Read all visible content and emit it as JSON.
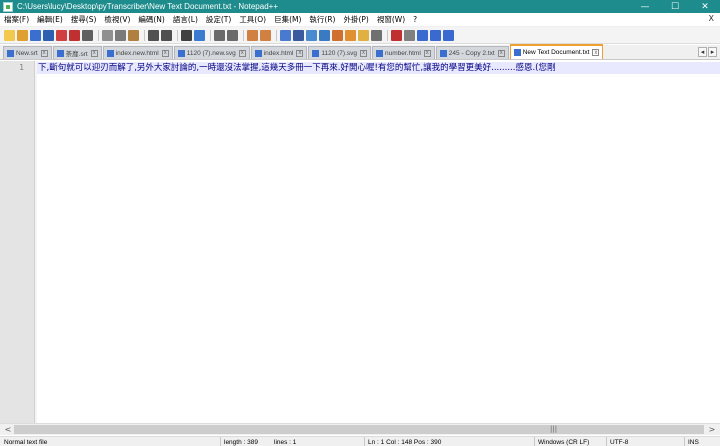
{
  "window": {
    "title": "C:\\Users\\lucy\\Desktop\\pyTranscriber\\New Text Document.txt - Notepad++",
    "minimize": "—",
    "maximize": "☐",
    "close": "✕"
  },
  "menu": {
    "items": [
      "檔案(F)",
      "編輯(E)",
      "搜尋(S)",
      "檢視(V)",
      "編碼(N)",
      "語言(L)",
      "設定(T)",
      "工具(O)",
      "巨集(M)",
      "執行(R)",
      "外掛(P)",
      "視窗(W)",
      "?"
    ],
    "close": "X"
  },
  "tabs": [
    {
      "label": "New.srt"
    },
    {
      "label": "荼靡.srt"
    },
    {
      "label": "index.new.html"
    },
    {
      "label": "1120 (7).new.svg"
    },
    {
      "label": "index.html"
    },
    {
      "label": "1120 (7).svg"
    },
    {
      "label": "number.html"
    },
    {
      "label": "245 - Copy 2.txt"
    },
    {
      "label": "New Text Document.txt",
      "active": true
    }
  ],
  "tab_nav": {
    "left": "◂",
    "right": "▸"
  },
  "editor": {
    "line_number": "1",
    "text": "下,斷句就可以迎刃而解了,另外大家討論的,一時還沒法掌握,這幾天多冊一下再來.好開心喔!有您的幫忙,讓我的學習更美好.........感恩.(您剛"
  },
  "scrollbar": {
    "left": "<",
    "right": ">",
    "grip": "|||"
  },
  "status": {
    "file_type": "Normal text file",
    "length": "length : 389",
    "lines": "lines : 1",
    "position": "Ln : 1    Col : 148    Pos : 390",
    "eol": "Windows (CR LF)",
    "encoding": "UTF-8",
    "mode": "INS"
  },
  "colors": {
    "titlebar": "#1e8c8c",
    "active_tab_border": "#f0a030",
    "text": "#000080"
  }
}
